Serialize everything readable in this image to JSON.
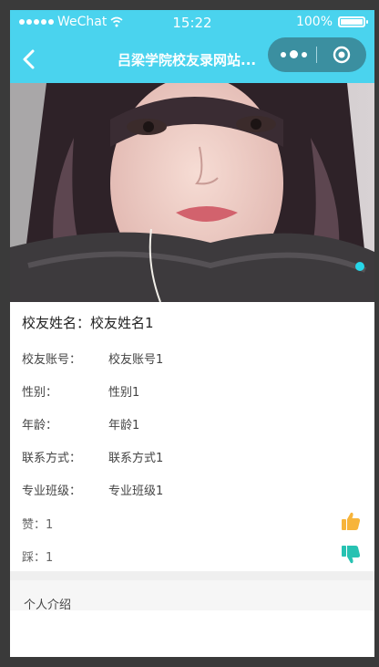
{
  "status_bar": {
    "carrier": "WeChat",
    "time": "15:22",
    "battery": "100%",
    "battery_level": 1.0
  },
  "nav": {
    "title": "吕梁学院校友录网站..."
  },
  "profile": {
    "name_label": "校友姓名：",
    "name_value": "校友姓名1",
    "fields": [
      {
        "label": "校友账号：",
        "value": "校友账号1"
      },
      {
        "label": "性别：",
        "value": "性别1"
      },
      {
        "label": "年龄：",
        "value": "年龄1"
      },
      {
        "label": "联系方式：",
        "value": "联系方式1"
      },
      {
        "label": "专业班级：",
        "value": "专业班级1"
      }
    ]
  },
  "votes": {
    "like_label": "赞：1",
    "dislike_label": "踩：1"
  },
  "intro": {
    "label": "个人介绍"
  },
  "colors": {
    "header": "#4ad3ee",
    "capsule": "#3b8fa0",
    "like": "#f7b43a",
    "dislike": "#27c2b2",
    "swiper_dot": "#27d6e8"
  },
  "icons": {
    "back": "chevron-left-icon",
    "more": "more-dots-icon",
    "close": "target-icon",
    "like": "thumbs-up-icon",
    "dislike": "thumbs-down-icon"
  }
}
